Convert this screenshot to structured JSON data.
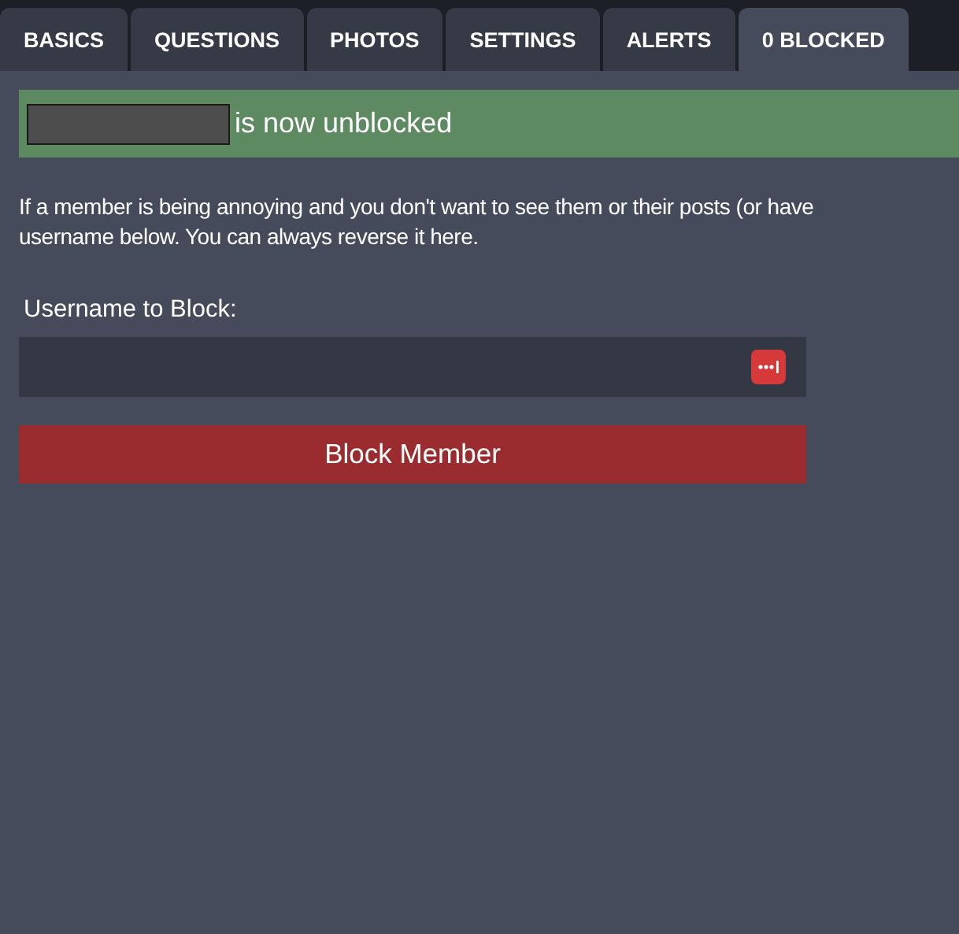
{
  "tabs": [
    {
      "label": "BASICS",
      "selected": false
    },
    {
      "label": "QUESTIONS",
      "selected": false
    },
    {
      "label": "PHOTOS",
      "selected": false
    },
    {
      "label": "SETTINGS",
      "selected": false
    },
    {
      "label": "ALERTS",
      "selected": false
    },
    {
      "label": "0 BLOCKED",
      "selected": true
    }
  ],
  "notice": {
    "text": "is now unblocked"
  },
  "description": [
    "If a member is being annoying and you don't want to see them or their posts (or have",
    "username below. You can always reverse it here."
  ],
  "form": {
    "label": "Username to Block:",
    "button": "Block Member"
  }
}
